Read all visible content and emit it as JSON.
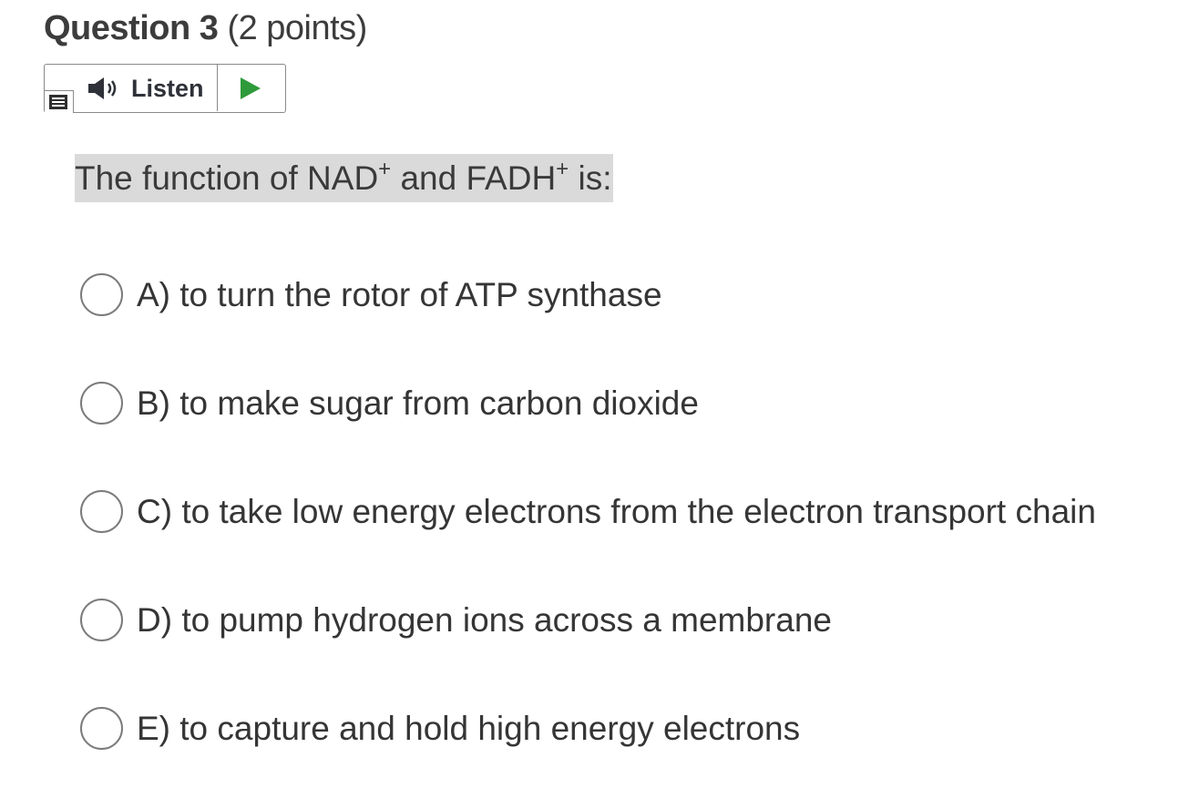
{
  "question": {
    "title": "Question 3",
    "points": "(2 points)"
  },
  "listen": {
    "label": "Listen",
    "menu_icon": "menu-icon",
    "speaker_icon": "speaker-icon",
    "play_icon": "play-icon",
    "play_color": "#2f9a3a"
  },
  "prompt": {
    "part1": "The function of NAD",
    "sup1": "+",
    "part2": " and FADH",
    "sup2": "+",
    "part3": " is:",
    "highlight_color": "#dadada"
  },
  "options": [
    {
      "label": "A) to turn the rotor of ATP synthase"
    },
    {
      "label": "B) to make sugar from carbon dioxide"
    },
    {
      "label": "C) to take low energy electrons from the electron transport chain"
    },
    {
      "label": "D) to pump hydrogen ions across a membrane"
    },
    {
      "label": "E) to capture and hold high energy electrons"
    }
  ]
}
